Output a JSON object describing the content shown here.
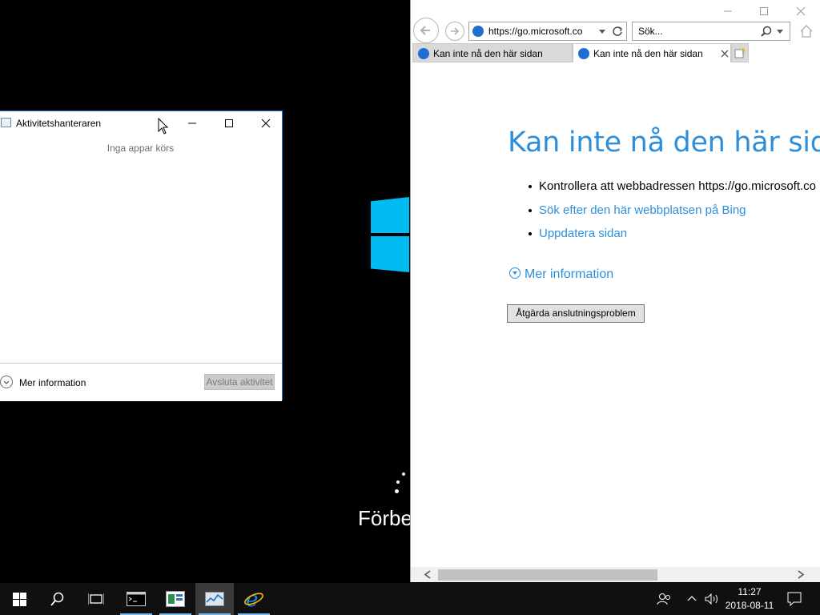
{
  "task_manager": {
    "title": "Aktivitetshanteraren",
    "empty_message": "Inga appar körs",
    "more_info": "Mer information",
    "end_task": "Avsluta aktivitet"
  },
  "desktop": {
    "preparing_text": "Förbe"
  },
  "ie": {
    "address": "https://go.microsoft.co",
    "search_placeholder": "Sök...",
    "tabs": [
      {
        "label": "Kan inte nå den här sidan"
      },
      {
        "label": "Kan inte nå den här sidan"
      }
    ],
    "heading": "Kan inte nå den här sidan",
    "bullets": {
      "check": "Kontrollera att webbadressen https://go.microsoft.co",
      "search": "Sök efter den här webbplatsen på Bing",
      "refresh": "Uppdatera sidan"
    },
    "more_info": "Mer information",
    "fix_button": "Åtgärda anslutningsproblem"
  },
  "taskbar": {
    "time": "11:27",
    "date": "2018-08-11"
  },
  "colors": {
    "accent_link": "#2d8fdb",
    "windows_logo": "#00bcf2",
    "taskbar": "#101010"
  }
}
